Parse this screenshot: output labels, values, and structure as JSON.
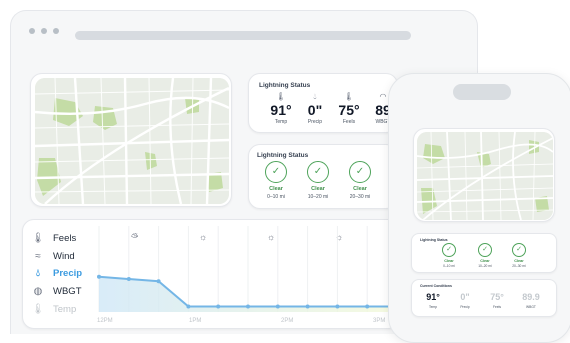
{
  "current_conditions_card": {
    "title": "Lightning Status",
    "metrics": [
      {
        "icon": "thermometer-icon",
        "value": "91°",
        "label": "Temp"
      },
      {
        "icon": "droplet-icon",
        "value": "0\"",
        "label": "Precip"
      },
      {
        "icon": "thermometer-icon",
        "value": "75°",
        "label": "Feels"
      },
      {
        "icon": "gauge-icon",
        "value": "89",
        "label": "WBGT"
      }
    ]
  },
  "lightning_card": {
    "title": "Lightning Status",
    "zones": [
      {
        "status": "Clear",
        "range": "0–10 mi"
      },
      {
        "status": "Clear",
        "range": "10–20 mi"
      },
      {
        "status": "Clear",
        "range": "20–30 mi"
      }
    ]
  },
  "forecast": {
    "layers": [
      {
        "icon": "thermometer-icon",
        "label": "Feels"
      },
      {
        "icon": "wind-icon",
        "label": "Wind"
      },
      {
        "icon": "droplet-icon",
        "label": "Precip",
        "active": true
      },
      {
        "icon": "globe-icon",
        "label": "WBGT"
      },
      {
        "icon": "thermometer-icon",
        "label": "Temp"
      }
    ],
    "time_labels": [
      "12PM",
      "1PM",
      "2PM",
      "3PM"
    ],
    "weather_icons": [
      "partly-cloudy-icon",
      "sun-icon",
      "sun-icon",
      "sun-icon"
    ]
  },
  "chart_data": {
    "type": "line",
    "xlabel": "",
    "ylabel": "",
    "x": [
      "12PM",
      "",
      "",
      "1PM",
      "",
      "",
      "2PM",
      "",
      "",
      "3PM",
      ""
    ],
    "series": [
      {
        "values": [
          0.32,
          0.3,
          0.28,
          0.05,
          0.05,
          0.05,
          0.05,
          0.05,
          0.05,
          0.05,
          0.05
        ]
      }
    ],
    "colors": {
      "line": "#74b6e6",
      "area_start": "#cfe7f7",
      "area_end": "#f3f9d9"
    }
  },
  "phone": {
    "lightning_card": {
      "title": "Lightning Status",
      "zones": [
        {
          "status": "Clear",
          "range": "0–10 mi"
        },
        {
          "status": "Clear",
          "range": "10–20 mi"
        },
        {
          "status": "Clear",
          "range": "20–30 mi"
        }
      ]
    },
    "current_card": {
      "title": "Current Conditions",
      "metrics": [
        {
          "value": "91°",
          "label": "Temp"
        },
        {
          "value": "0\"",
          "label": "Precip"
        },
        {
          "value": "75°",
          "label": "Feels"
        },
        {
          "value": "89.9",
          "label": "WBGT"
        }
      ]
    }
  },
  "colors": {
    "accent_green": "#4ea35a",
    "accent_blue": "#3b9be0",
    "map_bg": "#e9ede6",
    "map_park": "#c4dca6"
  }
}
